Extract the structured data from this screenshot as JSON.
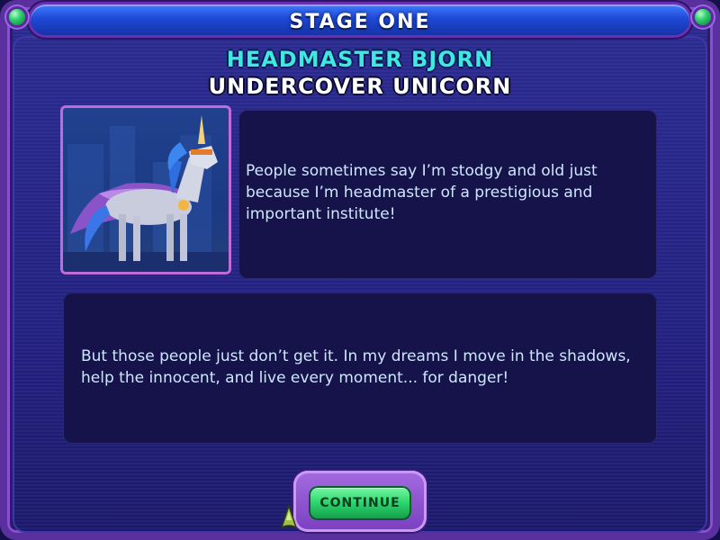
{
  "header": {
    "title": "STAGE ONE"
  },
  "character": {
    "name": "HEADMASTER BJORN",
    "subtitle": "UNDERCOVER UNICORN"
  },
  "dialogue": {
    "line1": "People sometimes say I’m stodgy and old just because I’m headmaster of a prestigious and important institute!",
    "line2": "But those people just don’t get it. In my dreams I move in the shadows, help the innocent, and live every moment... for danger!"
  },
  "footer": {
    "continue_label": "CONTINUE"
  },
  "icons": {
    "portrait": "unicorn-portrait",
    "cursor": "pointer-cursor-icon",
    "gems": "green-gem-icon"
  },
  "colors": {
    "title_bar": "#1f49d6",
    "name_text": "#3fe8e0",
    "continue_button": "#2bd46c"
  }
}
